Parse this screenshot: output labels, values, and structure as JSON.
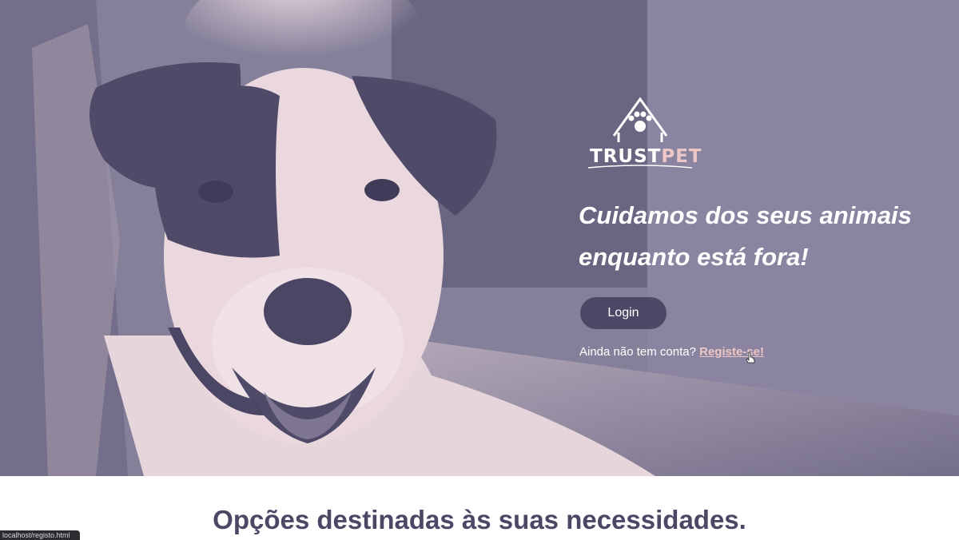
{
  "hero": {
    "logo_icon": "house-paw-icon",
    "logo_word_1": "TRUST",
    "logo_word_2": "PET",
    "headline": "Cuidamos dos seus animais enquanto está fora!",
    "login_label": "Login",
    "signup_prompt": "Ainda não tem conta?",
    "signup_link": "Registe-se!"
  },
  "section": {
    "title": "Opções destinadas às suas necessidades."
  },
  "status_bar": {
    "url": "localhost/registo.html"
  },
  "colors": {
    "accent": "#4b4866",
    "highlight": "#ecc7c5",
    "hero_tint": "#8a8299"
  }
}
